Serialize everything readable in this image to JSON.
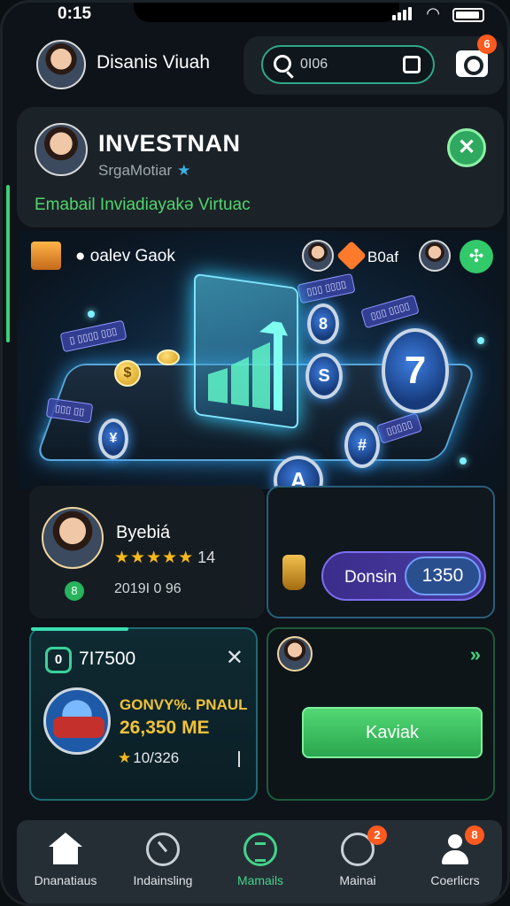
{
  "status_bar": {
    "time": "0:15"
  },
  "header": {
    "user_name": "Disanis Viuah",
    "search": {
      "value": "0I06"
    },
    "camera_badge": "6"
  },
  "profile": {
    "title": "INVESTNAN",
    "subtitle": "SrgaMotiar",
    "tagline": "Emabail Inviadiayakə Virtuac"
  },
  "hero": {
    "shop_label": "oalev Gaok",
    "boost_label": "B0af",
    "coin_symbol": "$",
    "orb_labels": [
      "8",
      "S",
      "7",
      "#",
      "A"
    ]
  },
  "agent": {
    "name": "Byebiá",
    "rating_stars": 5,
    "rating_count": "14",
    "meta": "2019I 0 96",
    "dot_icon": "8"
  },
  "deposit": {
    "label": "Donsin",
    "amount": "1350"
  },
  "asset": {
    "code": "7I7500",
    "hex_icon": "0",
    "name": "GONVY%. PNAUL",
    "value": "26,350 ME",
    "rating": "10/326"
  },
  "invest": {
    "cta_label": "Kaviak",
    "chevron": "»"
  },
  "tabs": [
    {
      "label": "Dnanatiaus",
      "icon": "home-icon"
    },
    {
      "label": "Indainsling",
      "icon": "chart-ring-icon"
    },
    {
      "label": "Mamails",
      "icon": "document-icon",
      "active": true
    },
    {
      "label": "Mainai",
      "icon": "face-icon",
      "badge": "2"
    },
    {
      "label": "Coerlicrs",
      "icon": "user-icon",
      "badge": "8"
    }
  ],
  "colors": {
    "accent_green": "#43d48a",
    "gold": "#f0c23a",
    "badge_orange": "#ff5a1f",
    "card_bg": "#1c2328"
  }
}
